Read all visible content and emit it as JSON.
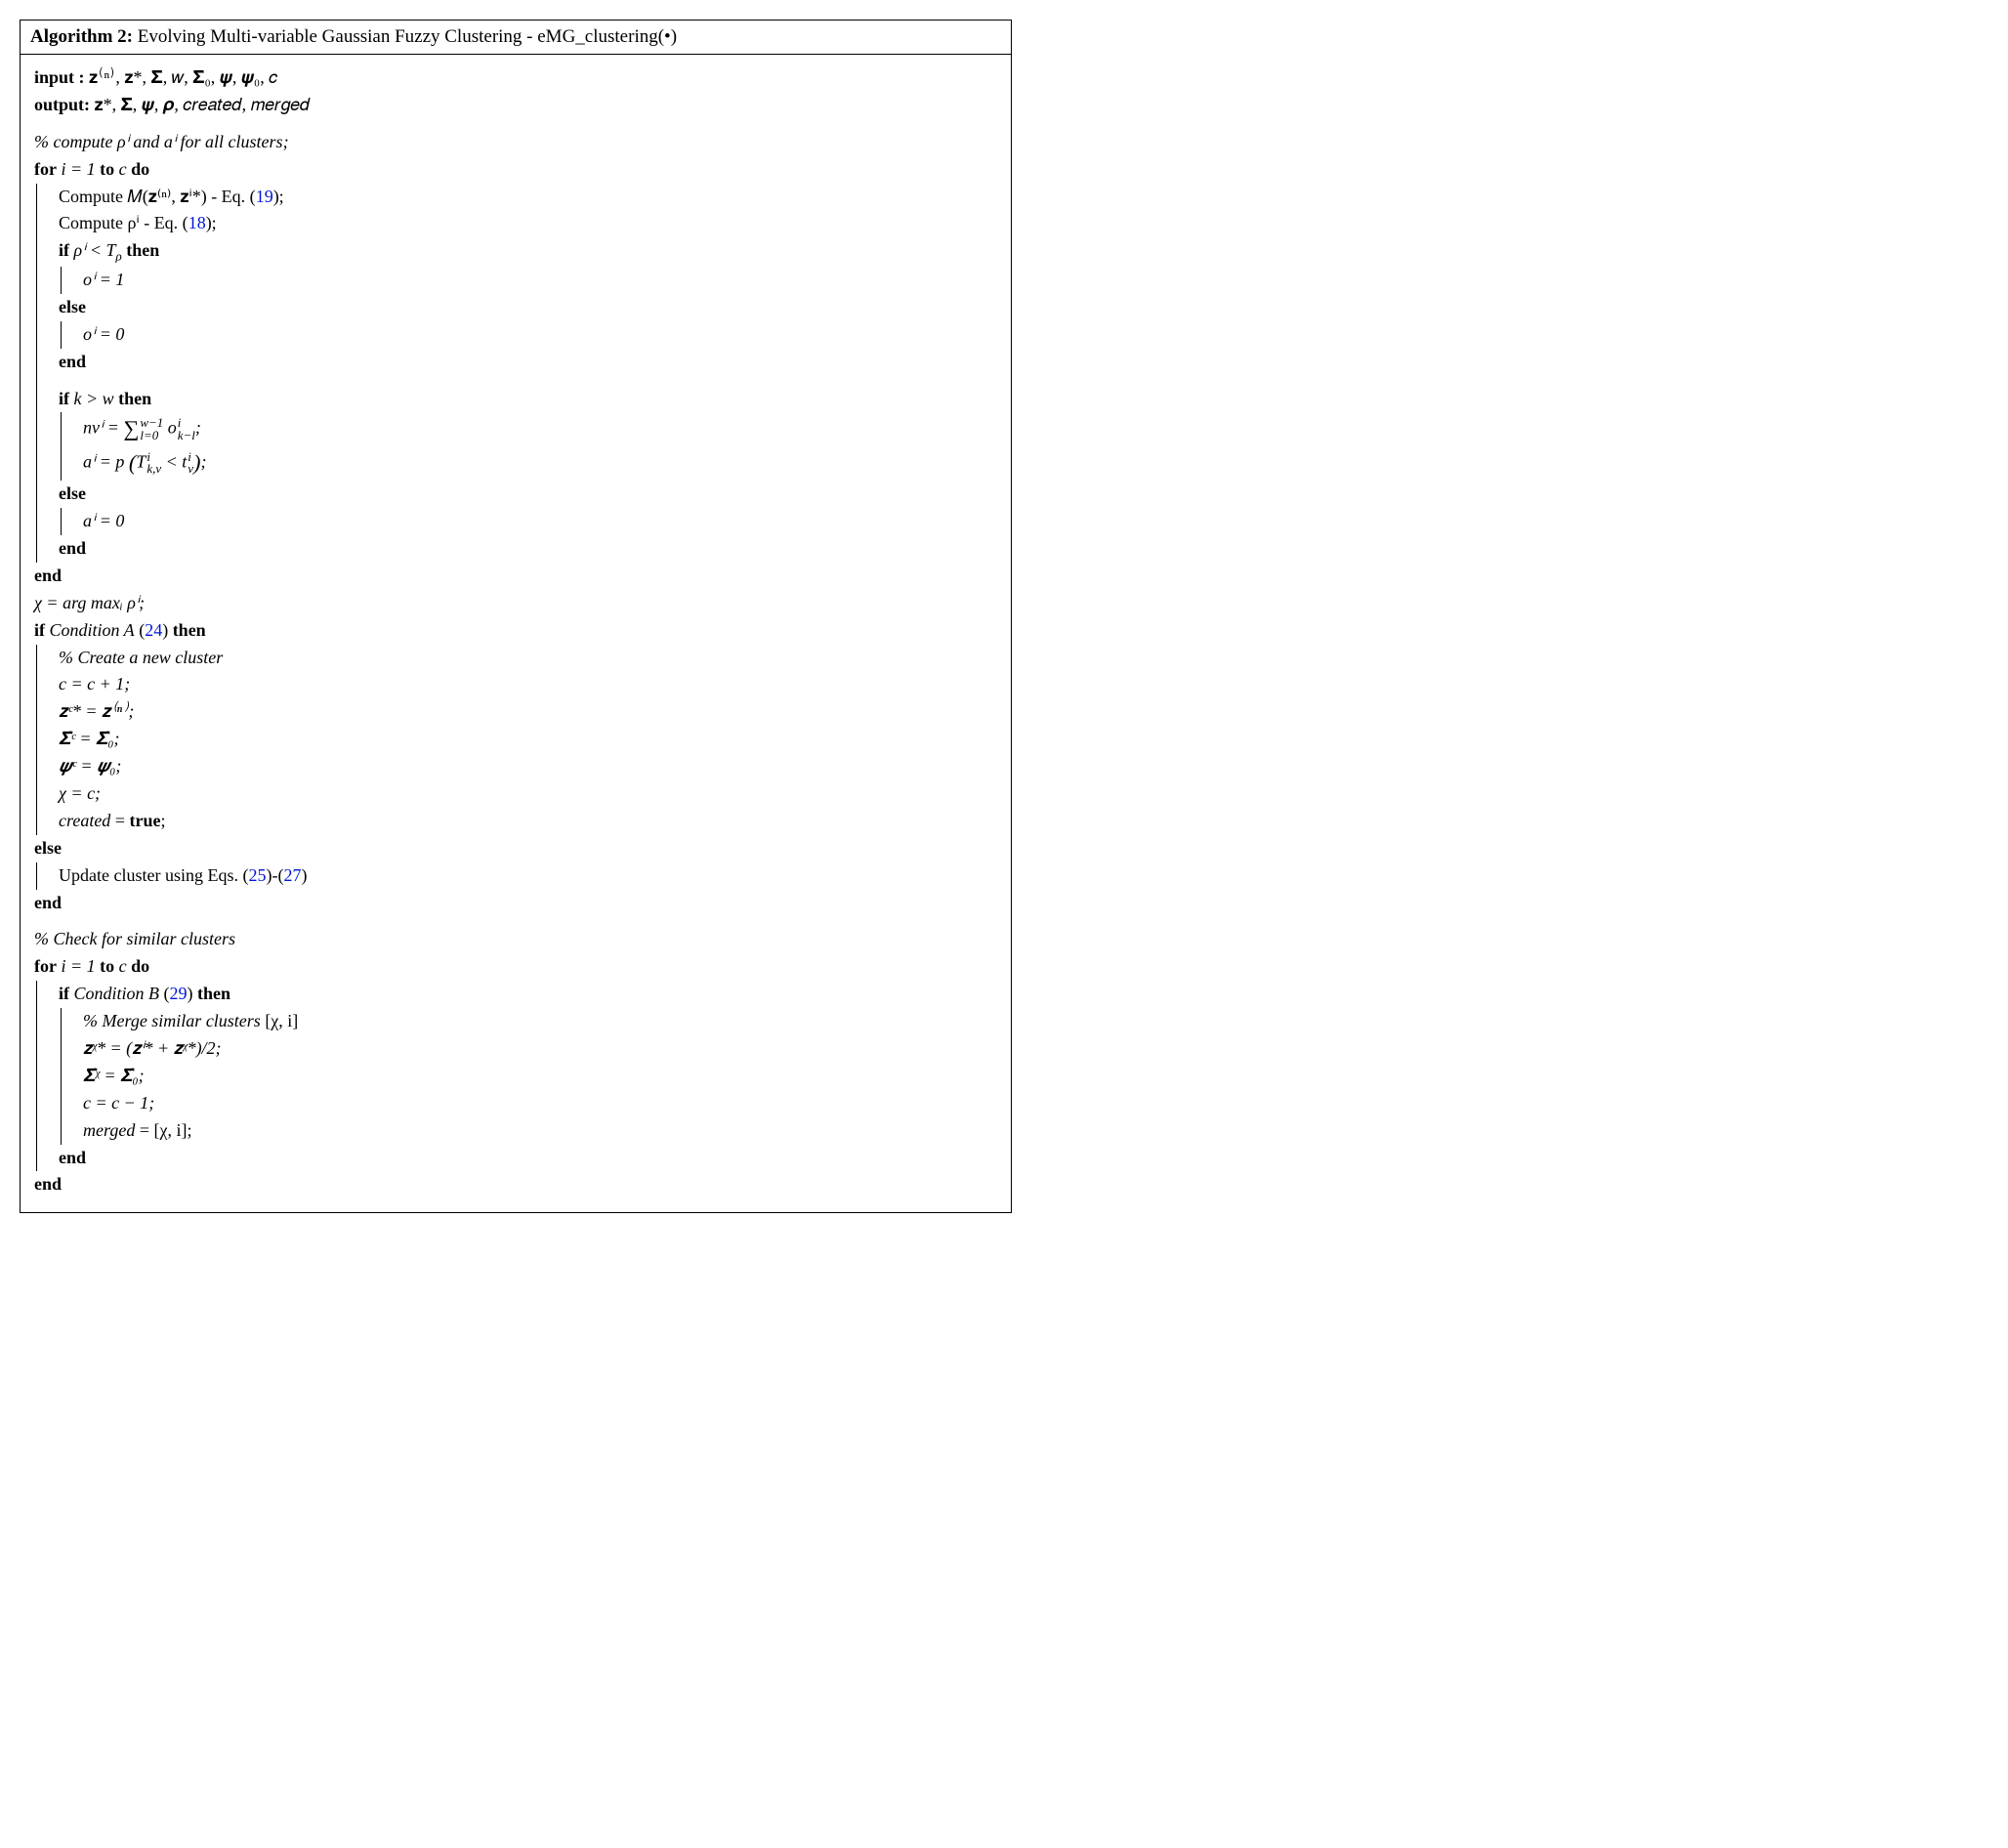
{
  "title": {
    "label": "Algorithm 2:",
    "name": "Evolving Multi-variable Gaussian Fuzzy Clustering - eMG_clustering(•)"
  },
  "io": {
    "input_label": "input   :",
    "input_val": "𝐳⁽ⁿ⁾, 𝐳*, 𝚺̂, 𝑤, 𝚺̂₀, 𝝍, 𝝍₀, 𝑐",
    "output_label": "output:",
    "output_val": "𝐳*, 𝚺̂, 𝝍, 𝝆, 𝑐𝑟𝑒𝑎𝑡𝑒𝑑, 𝑚𝑒𝑟𝑔𝑒𝑑"
  },
  "c1": "% compute ρⁱ and aⁱ for all clusters",
  "for1": {
    "head_for": "for",
    "head_cond": "i = 1",
    "head_to": "to",
    "head_end": "c",
    "head_do": "do",
    "l1a": "Compute 𝑀(𝐳⁽ⁿ⁾, 𝐳ⁱ*) - Eq. (",
    "l1b": "19",
    "l1c": ");",
    "l2a": "Compute ρⁱ - Eq. (",
    "l2b": "18",
    "l2c": ");",
    "if1_if": "if",
    "if1_cond": "ρⁱ < T",
    "if1_condsub": "ρ",
    "if1_then": "then",
    "if1_body": "oⁱ = 1",
    "else": "else",
    "if1_else_body": "oⁱ = 0",
    "end": "end",
    "if2_if": "if",
    "if2_cond": "k > w",
    "if2_then": "then",
    "if2_l1_lhs": "nvⁱ = ",
    "if2_l1_sum": "∑",
    "if2_l1_top": "w−1",
    "if2_l1_bot": "l=0",
    "if2_l1_rhs": " o",
    "if2_l1_sup": "i",
    "if2_l1_sub": "k−l",
    "if2_l2": "aⁱ = p ",
    "if2_l2_inner_a": "T",
    "if2_l2_inner_a_sup": "i",
    "if2_l2_inner_a_sub": "k,v",
    "if2_l2_mid": " < t",
    "if2_l2_inner_b_sup": "i",
    "if2_l2_inner_b_sub": "v",
    "if2_else_body": "aⁱ = 0"
  },
  "mid": {
    "chi": "χ = arg maxᵢ ρⁱ;",
    "ifA_if": "if",
    "ifA_cond": "Condition A",
    "ifA_ref_open": " (",
    "ifA_ref": "24",
    "ifA_ref_close": ")",
    "ifA_then": "then",
    "cA": "% Create a new cluster",
    "a1": "c = c + 1;",
    "a2": "𝐳ᶜ* = 𝐳⁽ⁿ⁾;",
    "a3": "𝚺̂ᶜ = 𝚺̂₀;",
    "a4": "𝝍ᶜ = 𝝍₀;",
    "a5": "χ = c;",
    "a6_l": "created",
    "a6_r": " = ",
    "a6_v": "true",
    "else": "else",
    "elsebody_a": "Update cluster using Eqs. (",
    "elsebody_b": "25",
    "elsebody_c": ")-(",
    "elsebody_d": "27",
    "elsebody_e": ")",
    "end": "end"
  },
  "last": {
    "cB": "% Check for similar clusters",
    "for_head_for": "for",
    "for_head_cond": "i = 1",
    "for_head_to": "to",
    "for_head_end": "c",
    "for_head_do": "do",
    "ifB_if": "if",
    "ifB_cond": "Condition B",
    "ifB_ref_open": " (",
    "ifB_ref": "29",
    "ifB_ref_close": ")",
    "ifB_then": "then",
    "cBB": "% Merge similar clusters",
    "cBBpair": " [χ, i]",
    "b1": "𝐳ᵡ* = (𝐳ⁱ* + 𝐳ᵡ*)/2;",
    "b2": "𝚺̂ᵡ = 𝚺̂₀;",
    "b3": "c = c − 1;",
    "b4_l": "merged",
    "b4_r": " = [χ, i];",
    "end": "end"
  }
}
